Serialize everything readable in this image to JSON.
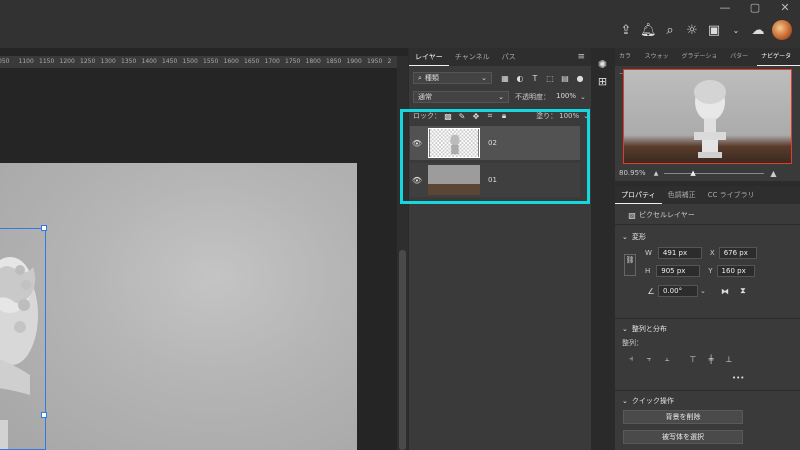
{
  "window_controls": [
    "—",
    "▢",
    "✕"
  ],
  "ruler_ticks": [
    "050",
    "1100",
    "1150",
    "1200",
    "1250",
    "1300",
    "1350",
    "1400",
    "1450",
    "1500",
    "1550",
    "1600",
    "1650",
    "1700",
    "1750",
    "1800",
    "1850",
    "1900",
    "1950",
    "2"
  ],
  "layers_panel": {
    "tabs": [
      "レイヤー",
      "チャンネル",
      "パス"
    ],
    "filter_label": "種類",
    "blend_mode": "通常",
    "opacity_label": "不透明度：",
    "opacity_value": "100%",
    "lock_label": "ロック：",
    "fill_label": "塗り：",
    "fill_value": "100%",
    "layers": [
      {
        "name": "02"
      },
      {
        "name": "01"
      }
    ]
  },
  "navigator_panel": {
    "tabs": [
      "カラー",
      "スウォッチ",
      "グラデーション",
      "パターン",
      "ナビゲーター"
    ],
    "zoom": "80.95%"
  },
  "properties_panel": {
    "tabs": [
      "プロパティ",
      "色調補正",
      "CC ライブラリ"
    ],
    "layer_type": "ピクセルレイヤー",
    "transform_title": "変形",
    "w_label": "W",
    "w_value": "491 px",
    "h_label": "H",
    "h_value": "905 px",
    "x_label": "X",
    "x_value": "676 px",
    "y_label": "Y",
    "y_value": "160 px",
    "angle_value": "0.00°",
    "align_title": "整列と分布",
    "align_label": "整列：",
    "more": "•••",
    "quick_title": "クイック操作",
    "remove_bg": "背景を削除",
    "select_subject": "被写体を選択"
  },
  "colors": {
    "highlight": "#14d8de",
    "selection": "#2e7be4",
    "nav_frame": "#e23a2b"
  }
}
